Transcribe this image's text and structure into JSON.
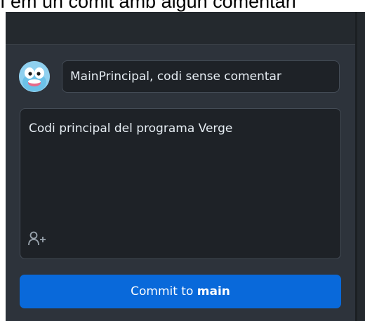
{
  "caption": "I em un comit amb algun comentari",
  "commit": {
    "summary_value": "MainPrincipal, codi sense comentar",
    "description_value": "Codi principal del programa Verge",
    "button_prefix": "Commit to",
    "branch": "main"
  },
  "icons": {
    "avatar": "avatar-cartoon-icon",
    "coauthor": "add-coauthor-icon"
  },
  "colors": {
    "panel": "#24292e",
    "panel_lower": "#2d333b",
    "field_bg": "#1e2227",
    "field_border": "#444c56",
    "text": "#e6edf3",
    "button": "#0969da"
  }
}
